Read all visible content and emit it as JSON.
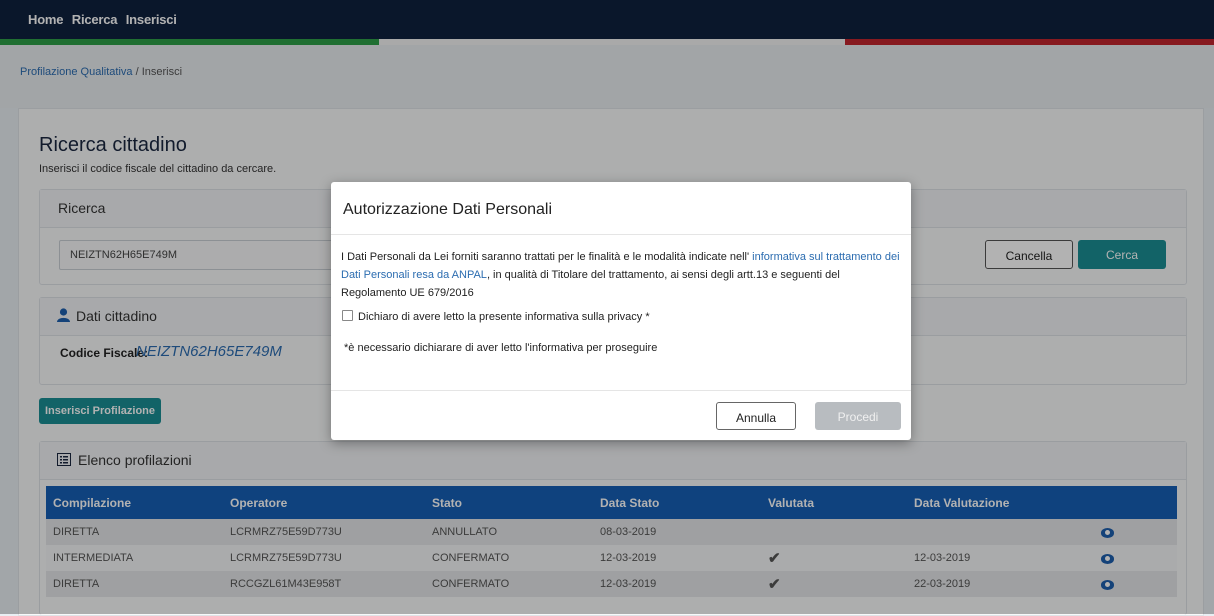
{
  "topnav": {
    "items": [
      "Home",
      "Ricerca",
      "Inserisci"
    ]
  },
  "flag_colors": {
    "green": "#2f9f48",
    "white": "#f2f2f2",
    "red": "#c2262e"
  },
  "breadcrumb": {
    "parent": "Profilazione Qualitativa",
    "separator": "/",
    "current": "Inserisci"
  },
  "page": {
    "title": "Ricerca cittadino",
    "subtitle": "Inserisci il codice fiscale del cittadino da cercare."
  },
  "search_panel": {
    "heading": "Ricerca",
    "input_value": "NEIZTN62H65E749M",
    "cancel_label": "Cancella",
    "search_label": "Cerca"
  },
  "citizen_panel": {
    "heading": "Dati cittadino",
    "icon": "user-icon",
    "cf_label": "Codice Fiscale:",
    "cf_value": "NEIZTN62H65E749M"
  },
  "insert_button": "Inserisci Profilazione",
  "profiles_panel": {
    "heading": "Elenco profilazioni",
    "icon": "list-icon",
    "columns": [
      "Compilazione",
      "Operatore",
      "Stato",
      "Data Stato",
      "Valutata",
      "Data Valutazione",
      ""
    ],
    "rows": [
      {
        "compilazione": "DIRETTA",
        "operatore": "LCRMRZ75E59D773U",
        "stato": "ANNULLATO",
        "data_stato": "08-03-2019",
        "valutata": "",
        "data_valutazione": "",
        "view_icon": "eye-icon"
      },
      {
        "compilazione": "INTERMEDIATA",
        "operatore": "LCRMRZ75E59D773U",
        "stato": "CONFERMATO",
        "data_stato": "12-03-2019",
        "valutata": "✔",
        "data_valutazione": "12-03-2019",
        "view_icon": "eye-icon"
      },
      {
        "compilazione": "DIRETTA",
        "operatore": "RCCGZL61M43E958T",
        "stato": "CONFERMATO",
        "data_stato": "12-03-2019",
        "valutata": "✔",
        "data_valutazione": "22-03-2019",
        "view_icon": "eye-icon"
      }
    ]
  },
  "modal": {
    "title": "Autorizzazione Dati Personali",
    "body_pre": "I Dati Personali da Lei forniti saranno trattati per le finalità e le modalità indicate nell' ",
    "body_link": "informativa sul trattamento dei Dati Personali resa da ANPAL",
    "body_post": ", in qualità di Titolare del trattamento, ai sensi degli artt.13 e seguenti del Regolamento UE 679/2016",
    "checkbox_label": "Dichiaro di avere letto la presente informativa sulla privacy *",
    "checkbox_checked": false,
    "note": "*è necessario dichiarare di aver letto l'informativa per proseguire",
    "cancel_label": "Annulla",
    "proceed_label": "Procedi"
  },
  "colors": {
    "navy": "#0f213e",
    "teal": "#1a8f94",
    "table_header": "#165fb5",
    "link": "#2b6cb0"
  }
}
